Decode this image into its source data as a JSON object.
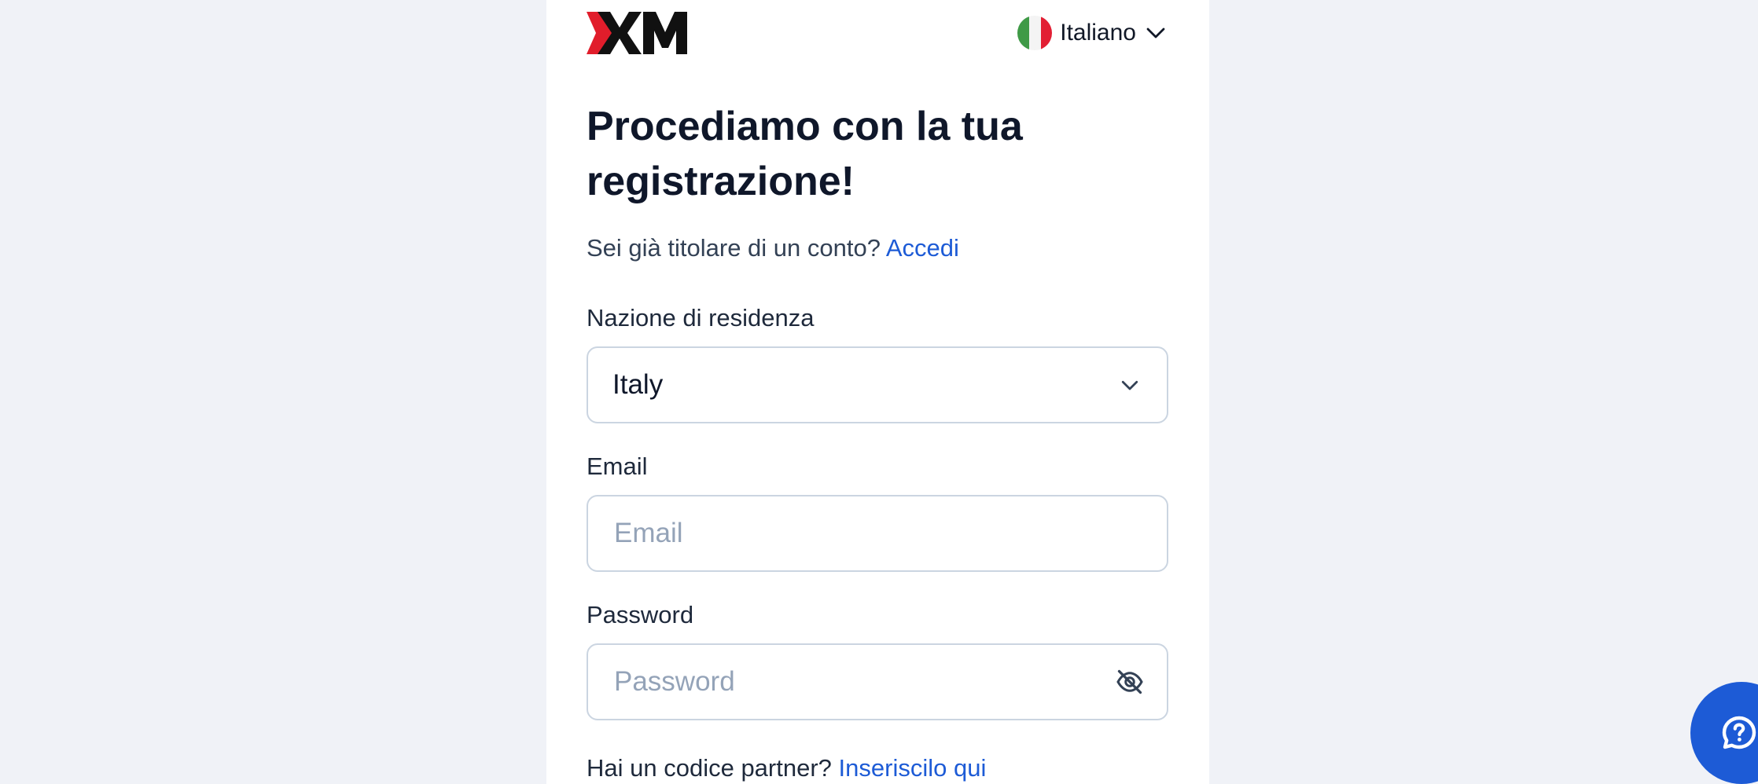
{
  "brand": {
    "logo_text": "XM",
    "accent_color": "#e11d2b"
  },
  "language": {
    "label": "Italiano",
    "flag_icon": "italy-flag-icon"
  },
  "heading": {
    "title": "Procediamo con la tua registrazione!"
  },
  "account": {
    "prompt": "Sei già titolare di un conto?",
    "login_link": "Accedi"
  },
  "country": {
    "label": "Nazione di residenza",
    "selected": "Italy"
  },
  "email": {
    "label": "Email",
    "placeholder": "Email",
    "value": ""
  },
  "password": {
    "label": "Password",
    "placeholder": "Password",
    "value": ""
  },
  "partner": {
    "prompt": "Hai un codice partner?",
    "link": "Inseriscilo qui"
  },
  "colors": {
    "link": "#1d5bd6",
    "help_button": "#1d5bd6"
  },
  "help": {
    "icon": "help-chat-icon"
  }
}
